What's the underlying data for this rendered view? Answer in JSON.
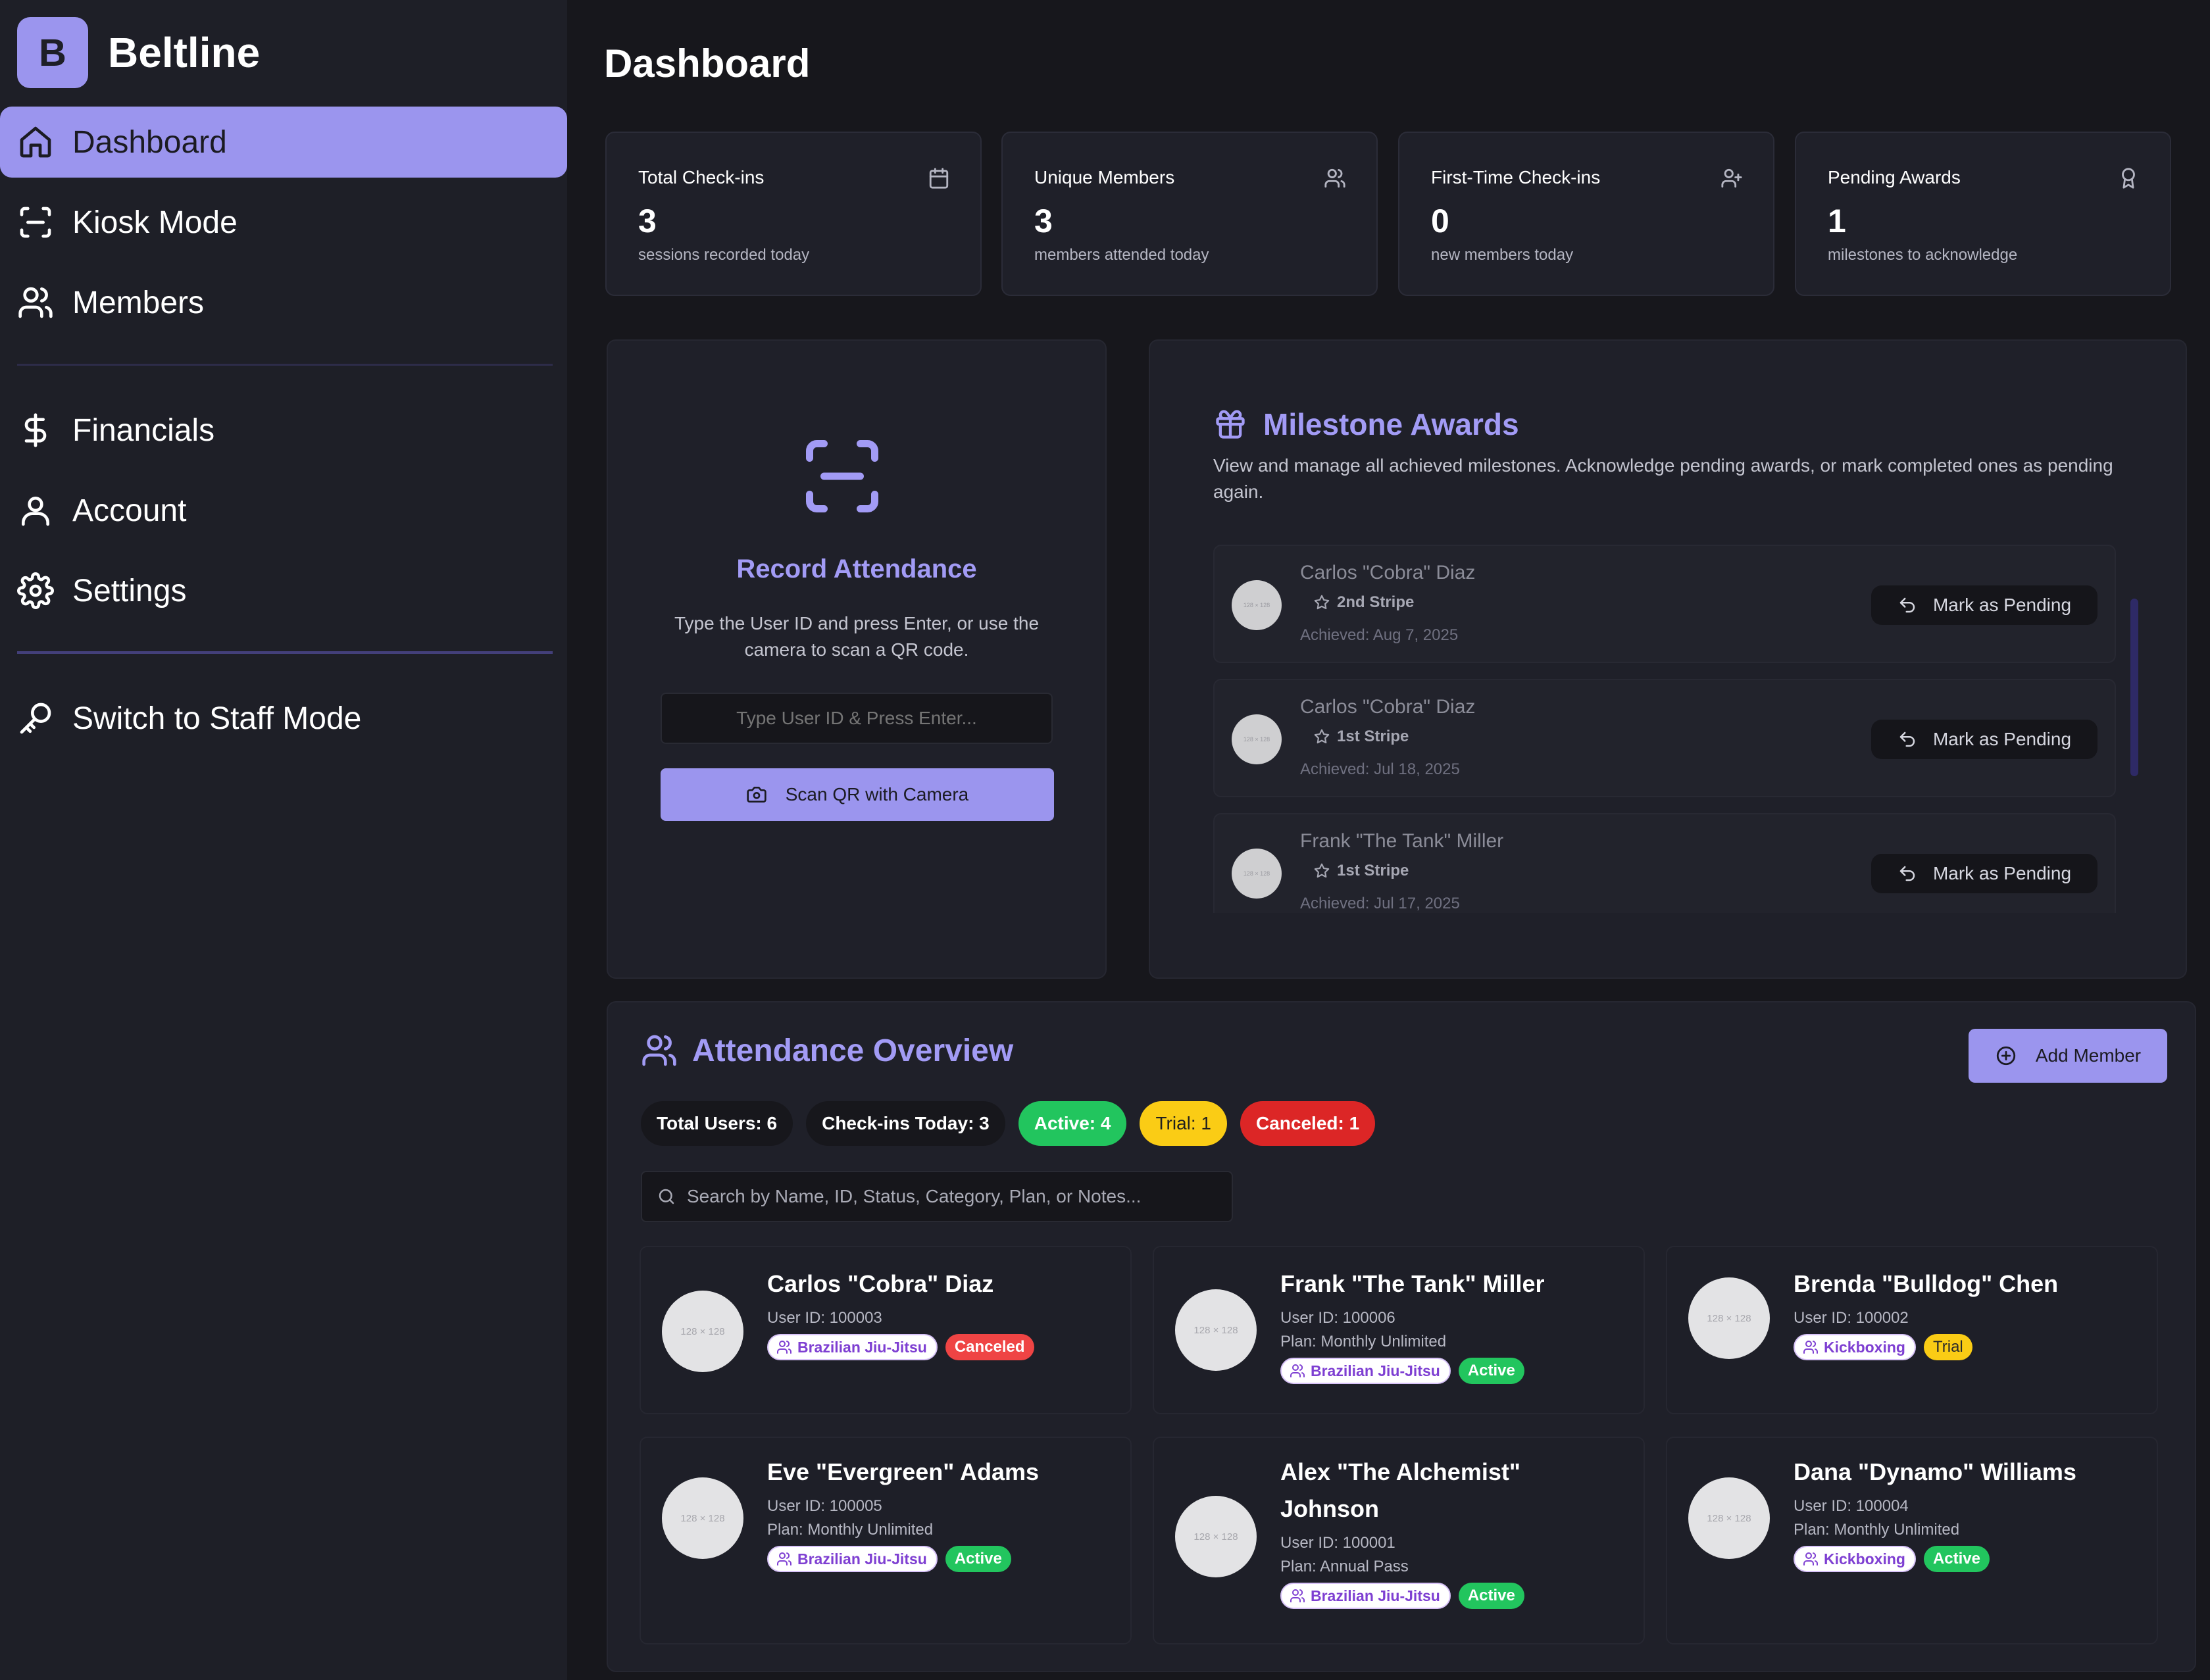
{
  "brand": {
    "logo_letter": "B",
    "name": "Beltline"
  },
  "sidebar": {
    "items": [
      {
        "label": "Dashboard",
        "icon": "home-icon",
        "active": true
      },
      {
        "label": "Kiosk Mode",
        "icon": "scan-icon"
      },
      {
        "label": "Members",
        "icon": "users-icon"
      },
      {
        "label": "Financials",
        "icon": "dollar-icon"
      },
      {
        "label": "Account",
        "icon": "user-icon"
      },
      {
        "label": "Settings",
        "icon": "gear-icon"
      },
      {
        "label": "Switch to Staff Mode",
        "icon": "key-icon"
      }
    ]
  },
  "page": {
    "title": "Dashboard"
  },
  "stats": [
    {
      "label": "Total Check-ins",
      "value": "3",
      "sub": "sessions recorded today",
      "icon": "calendar-icon"
    },
    {
      "label": "Unique Members",
      "value": "3",
      "sub": "members attended today",
      "icon": "users-icon"
    },
    {
      "label": "First-Time Check-ins",
      "value": "0",
      "sub": "new members today",
      "icon": "user-plus-icon"
    },
    {
      "label": "Pending Awards",
      "value": "1",
      "sub": "milestones to acknowledge",
      "icon": "award-icon"
    }
  ],
  "record_attendance": {
    "title": "Record Attendance",
    "description": "Type the User ID and press Enter, or use the camera to scan a QR code.",
    "input_placeholder": "Type User ID & Press Enter...",
    "scan_button": "Scan QR with Camera"
  },
  "milestones": {
    "title": "Milestone Awards",
    "description": "View and manage all achieved milestones. Acknowledge pending awards, or mark completed ones as pending again.",
    "avatar_placeholder": "128 × 128",
    "items": [
      {
        "name": "Carlos \"Cobra\" Diaz",
        "award": "2nd Stripe",
        "achieved": "Achieved: Aug 7, 2025",
        "action": "Mark as Pending"
      },
      {
        "name": "Carlos \"Cobra\" Diaz",
        "award": "1st Stripe",
        "achieved": "Achieved: Jul 18, 2025",
        "action": "Mark as Pending"
      },
      {
        "name": "Frank \"The Tank\" Miller",
        "award": "1st Stripe",
        "achieved": "Achieved: Jul 17, 2025",
        "action": "Mark as Pending"
      }
    ]
  },
  "attendance": {
    "title": "Attendance Overview",
    "add_button": "Add Member",
    "pills": {
      "total_users": "Total Users: 6",
      "checkins_today": "Check-ins Today: 3",
      "active": "Active: 4",
      "trial": "Trial: 1",
      "canceled": "Canceled: 1"
    },
    "search_placeholder": "Search by Name, ID, Status, Category, Plan, or Notes...",
    "avatar_placeholder": "128 × 128",
    "members": [
      {
        "name": "Carlos \"Cobra\" Diaz",
        "user_id": "User ID: 100003",
        "plan": "",
        "category": "Brazilian Jiu-Jitsu",
        "status": "Canceled"
      },
      {
        "name": "Frank \"The Tank\" Miller",
        "user_id": "User ID: 100006",
        "plan": "Plan: Monthly Unlimited",
        "category": "Brazilian Jiu-Jitsu",
        "status": "Active"
      },
      {
        "name": "Brenda \"Bulldog\" Chen",
        "user_id": "User ID: 100002",
        "plan": "",
        "category": "Kickboxing",
        "status": "Trial"
      },
      {
        "name": "Eve \"Evergreen\" Adams",
        "user_id": "User ID: 100005",
        "plan": "Plan: Monthly Unlimited",
        "category": "Brazilian Jiu-Jitsu",
        "status": "Active"
      },
      {
        "name": "Alex \"The Alchemist\" Johnson",
        "user_id": "User ID: 100001",
        "plan": "Plan: Annual Pass",
        "category": "Brazilian Jiu-Jitsu",
        "status": "Active"
      },
      {
        "name": "Dana \"Dynamo\" Williams",
        "user_id": "User ID: 100004",
        "plan": "Plan: Monthly Unlimited",
        "category": "Kickboxing",
        "status": "Active"
      }
    ]
  },
  "colors": {
    "accent": "#9b95ee",
    "accent_text": "#a29bf5",
    "background": "#17171c",
    "sidebar": "#1e1f27",
    "active_green": "#22c55e",
    "trial_yellow": "#facc15",
    "canceled_red": "#dc2626"
  }
}
